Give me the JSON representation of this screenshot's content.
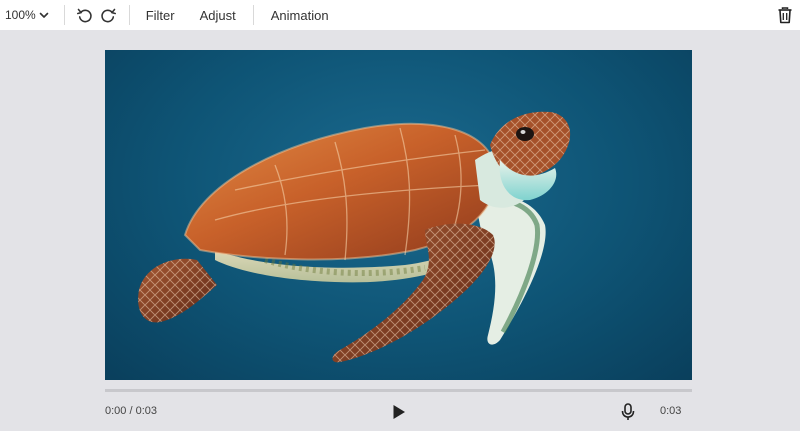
{
  "toolbar": {
    "zoom_value": "100%",
    "zoom_icon": "chevron-down-icon",
    "undo_icon": "undo-icon",
    "redo_icon": "redo-icon",
    "filter_label": "Filter",
    "adjust_label": "Adjust",
    "animation_label": "Animation",
    "delete_icon": "trash-icon"
  },
  "canvas": {
    "image_subject": "sea turtle swimming in blue water"
  },
  "player": {
    "time_display": "0:00 / 0:03",
    "duration": "0:03",
    "progress": 0,
    "play_icon": "play-icon",
    "mic_icon": "microphone-icon"
  },
  "colors": {
    "water": "#0e5475",
    "toolbar_bg": "#ffffff",
    "workspace_bg": "#e3e3e7",
    "timeline": "#c8c8cc"
  }
}
